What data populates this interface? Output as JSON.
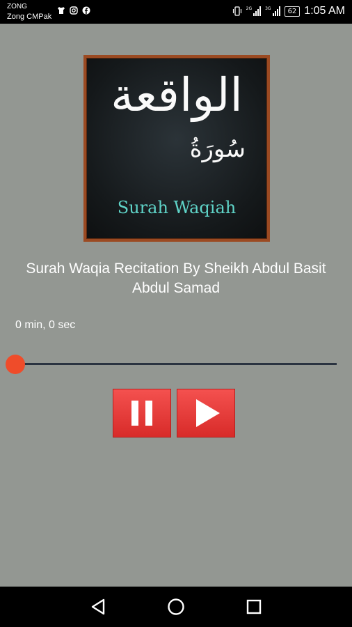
{
  "status_bar": {
    "carrier_line1": "ZONG",
    "carrier_line2": "Zong CMPak",
    "network_1": "2G",
    "network_2": "3G",
    "battery": "62",
    "time": "1:05 AM",
    "left_icons": [
      "shirt-icon",
      "instagram-icon",
      "facebook-icon"
    ]
  },
  "cover": {
    "arabic_title": "الواقعة",
    "arabic_sub": "سُورَةُ",
    "title": "Surah Waqiah",
    "frame_color": "#9b4a22",
    "title_color": "#5fd4c8"
  },
  "track": {
    "title": "Surah Waqia Recitation By Sheikh Abdul Basit Abdul Samad"
  },
  "player": {
    "elapsed": "0 min, 0 sec",
    "progress": 0,
    "accent_color": "#ef4c2a",
    "pause_icon": "pause-icon",
    "play_icon": "play-icon"
  },
  "nav_bar": {
    "buttons": [
      "back-icon",
      "home-icon",
      "recent-apps-icon"
    ]
  }
}
